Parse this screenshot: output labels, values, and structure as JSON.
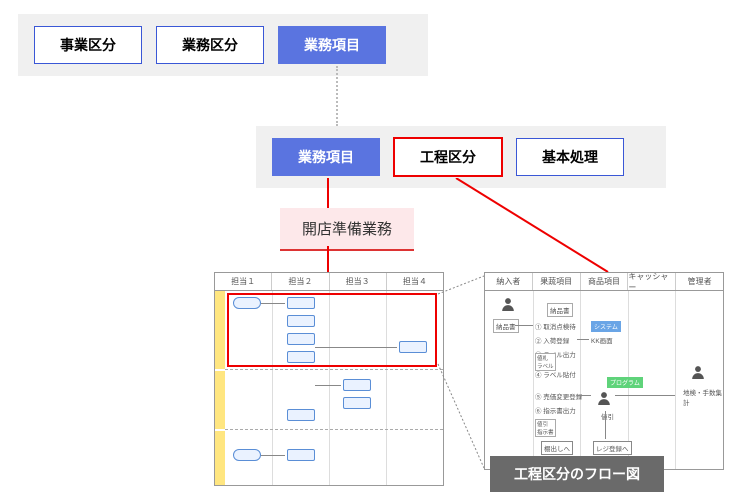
{
  "tabs_top": {
    "business_division": "事業区分",
    "operation_division": "業務区分",
    "operation_item": "業務項目"
  },
  "tabs_mid": {
    "operation_item": "業務項目",
    "process_division": "工程区分",
    "basic_process": "基本処理"
  },
  "task_label": "開店準備業務",
  "left_panel": {
    "headers": [
      "担当１",
      "担当２",
      "担当３",
      "担当４"
    ]
  },
  "right_panel": {
    "headers": [
      "納入者",
      "果蔬項目",
      "商品項目",
      "キャッシャー",
      "管理者"
    ],
    "items": {
      "noujin": "納品書",
      "slip": "納品書",
      "check1": "① 取消点検待",
      "check2": "② 入荷登録",
      "check3": "③ ラベル出力",
      "check4": "④ ラベル貼付",
      "check5": "⑤ 売価変更登録",
      "check6": "⑥ 指示書出力",
      "system": "システム",
      "kk_screen": "KK画面",
      "label_tag": "値札\nラベル",
      "program": "プログラム",
      "discount": "値引",
      "slip2": "値引\n指示書",
      "register": "レジ登録へ",
      "shelf": "棚出しへ",
      "fee": "地検・手数集計"
    }
  },
  "caption": "工程区分のフロー図"
}
